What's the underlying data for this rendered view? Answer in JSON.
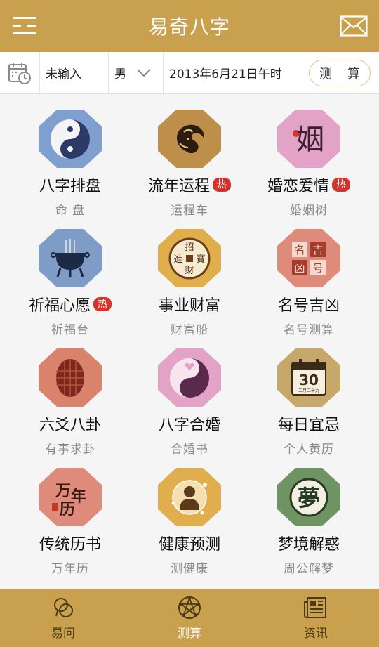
{
  "header": {
    "title": "易奇八字",
    "menu_icon": "menu-icon",
    "mail_icon": "mail-icon"
  },
  "inputbar": {
    "calendar_icon": "calendar-clock-icon",
    "name_value": "未输入",
    "gender_value": "男",
    "date_value": "2013年6月21日午时",
    "calc_label": "测 算"
  },
  "grid": {
    "items": [
      {
        "label": "八字排盘",
        "sub": "命 盘",
        "hot": "",
        "color": "#7fa0cf",
        "icon": "yin-yang-icon"
      },
      {
        "label": "流年运程",
        "sub": "运程车",
        "hot": "热",
        "color": "#bd8f4a",
        "icon": "goat-icon"
      },
      {
        "label": "婚恋爱情",
        "sub": "婚姻树",
        "hot": "热",
        "color": "#e3a3c6",
        "icon": "marriage-character-icon",
        "glyph": "姻"
      },
      {
        "label": "祈福心愿",
        "sub": "祈福台",
        "hot": "热",
        "color": "#7f9cc6",
        "icon": "incense-burner-icon"
      },
      {
        "label": "事业财富",
        "sub": "财富船",
        "hot": "",
        "color": "#e0ae4c",
        "icon": "coin-icon",
        "glyphs": [
          "招",
          "财",
          "進",
          "寶"
        ]
      },
      {
        "label": "名号吉凶",
        "sub": "名号测算",
        "hot": "",
        "color": "#df8b7b",
        "icon": "name-tiles-icon",
        "glyphs": [
          "名",
          "吉",
          "凶",
          "号"
        ]
      },
      {
        "label": "六爻八卦",
        "sub": "有事求卦",
        "hot": "",
        "color": "#d9826c",
        "icon": "turtle-shell-icon"
      },
      {
        "label": "八字合婚",
        "sub": "合婚书",
        "hot": "",
        "color": "#e3a3c6",
        "icon": "heart-yin-yang-icon"
      },
      {
        "label": "每日宜忌",
        "sub": "个人黄历",
        "hot": "",
        "color": "#c6a96a",
        "icon": "daily-calendar-icon",
        "cal_num": "30",
        "cal_text": "二月二十九"
      },
      {
        "label": "传统历书",
        "sub": "万年历",
        "hot": "",
        "color": "#df8b7b",
        "icon": "almanac-character-icon",
        "glyphs": [
          "万",
          "年",
          "历"
        ]
      },
      {
        "label": "健康预测",
        "sub": "测健康",
        "hot": "",
        "color": "#e0ae4c",
        "icon": "body-silhouette-icon"
      },
      {
        "label": "梦境解惑",
        "sub": "周公解梦",
        "hot": "",
        "color": "#6f9464",
        "icon": "dream-character-icon",
        "glyph": "夢"
      }
    ]
  },
  "tabbar": {
    "tabs": [
      {
        "label": "易问",
        "icon": "chat-icon"
      },
      {
        "label": "测算",
        "icon": "pentagram-icon"
      },
      {
        "label": "资讯",
        "icon": "news-icon"
      }
    ]
  },
  "colors": {
    "brand": "#c9a04e",
    "hot": "#d9302a"
  }
}
